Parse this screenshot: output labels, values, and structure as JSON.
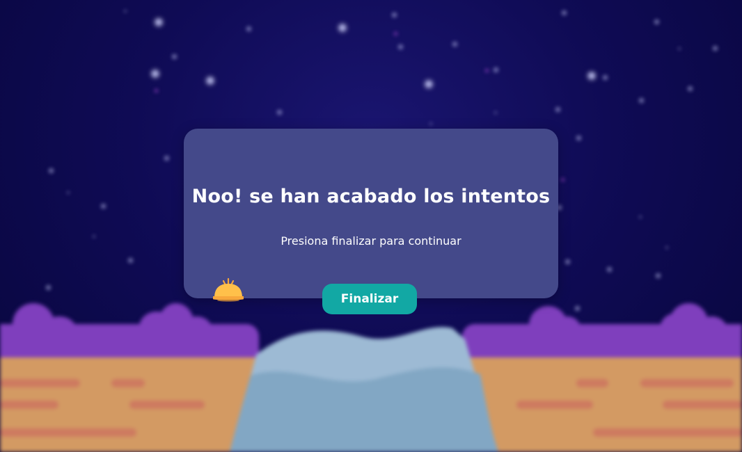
{
  "dialog": {
    "title": "Noo! se han acabado los intentos",
    "subtitle": "Presiona finalizar para continuar",
    "finish_label": "Finalizar"
  },
  "colors": {
    "sky": "#0f0b55",
    "dialog_bg": "#44498a",
    "button_bg": "#12a8a4",
    "cloud": "#7f3fbd",
    "cliff": "#d39a63",
    "water": "#86a9c6"
  },
  "icons": {
    "character": "chick-icon"
  }
}
